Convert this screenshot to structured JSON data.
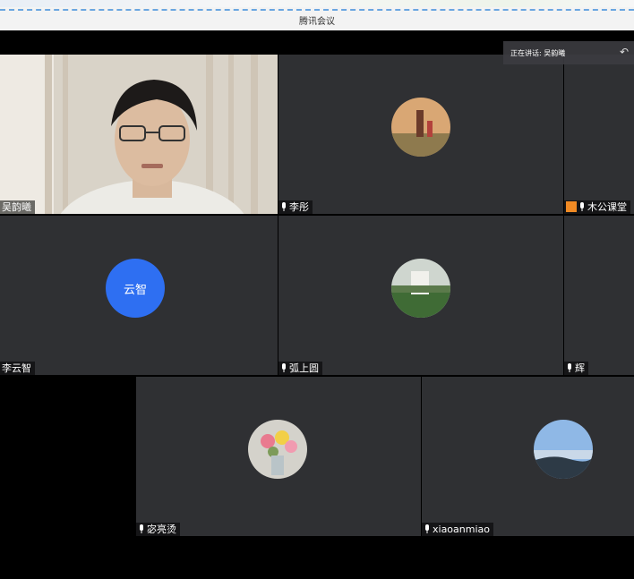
{
  "window": {
    "title": "腾讯会议"
  },
  "speaking": {
    "label": "正在讲话: 吴韵曦"
  },
  "participants": [
    {
      "name": "吴韵曦",
      "kind": "camera"
    },
    {
      "name": "李彤",
      "kind": "photo",
      "avatar": "family-walk-photo"
    },
    {
      "name": "木公课堂",
      "kind": "blank",
      "host_badge": true
    },
    {
      "name": "李云智",
      "kind": "text",
      "avatar_text": "云智"
    },
    {
      "name": "弧上圆",
      "kind": "photo",
      "avatar": "park-statue-photo"
    },
    {
      "name": "辉",
      "kind": "blank"
    },
    {
      "name": "宓亮烫",
      "kind": "photo",
      "avatar": "flower-vase-photo"
    },
    {
      "name": "xiaoanmiao",
      "kind": "photo",
      "avatar": "sky-landscape-photo"
    }
  ],
  "colors": {
    "tile_bg": "#2f3033",
    "text_avatar": "#2e6ff2",
    "accent": "#4a90e2"
  }
}
